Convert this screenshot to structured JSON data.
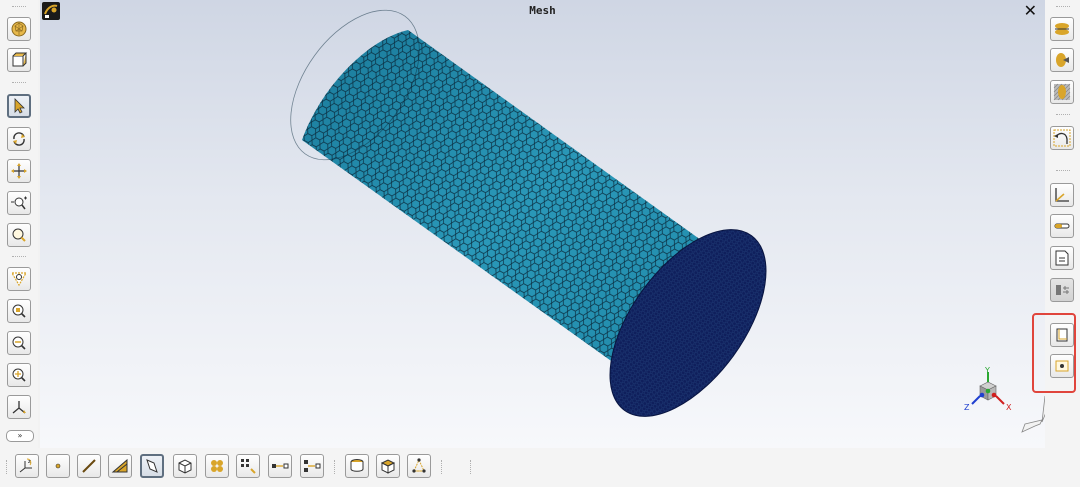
{
  "window": {
    "title": "Mesh",
    "close_glyph": "✕"
  },
  "colors": {
    "mesh_fill": "#1e86a6",
    "mesh_end_cap": "#0f1f5c",
    "mesh_lines": "#0a2a3c",
    "accent": "#d9a52a",
    "highlight": "#e0453c"
  },
  "left_toolbar": [
    {
      "name": "geodesic-sphere-icon"
    },
    {
      "name": "box-view-icon"
    },
    {
      "name": "select-arrow-icon",
      "active": true
    },
    {
      "name": "rotate-icon"
    },
    {
      "name": "pan-icon"
    },
    {
      "name": "zoom-in-out-icon"
    },
    {
      "name": "zoom-icon"
    },
    {
      "name": "fit-view-icon"
    },
    {
      "name": "zoom-window-icon"
    },
    {
      "name": "zoom-previous-icon"
    },
    {
      "name": "zoom-next-icon"
    },
    {
      "name": "axis-view-icon"
    }
  ],
  "expander_glyph": "»",
  "right_toolbar": [
    {
      "name": "shaded-layers-icon"
    },
    {
      "name": "shaded-split-icon"
    },
    {
      "name": "hatched-oval-icon"
    },
    {
      "name": "rotate-back-icon"
    },
    {
      "name": "axes-corner-icon"
    },
    {
      "name": "color-bar-icon"
    },
    {
      "name": "document-icon"
    },
    {
      "name": "grey-settings-icon"
    },
    {
      "name": "frame-icon"
    },
    {
      "name": "dot-frame-icon"
    }
  ],
  "bottom_toolbar": [
    {
      "name": "coordinate-system-icon"
    },
    {
      "name": "point-icon"
    },
    {
      "name": "line-icon"
    },
    {
      "name": "triangle-face-icon"
    },
    {
      "name": "face-icon",
      "active": true
    },
    {
      "name": "cube-icon"
    },
    {
      "name": "spheres-icon"
    },
    {
      "name": "grid-points-icon"
    },
    {
      "name": "node-to-node-icon"
    },
    {
      "name": "node-link-icon"
    },
    {
      "name": "cylinder-face-icon"
    },
    {
      "name": "cube-face-icon"
    },
    {
      "name": "network-icon"
    }
  ],
  "triad": {
    "x_label": "X",
    "y_label": "Y",
    "z_label": "Z"
  }
}
